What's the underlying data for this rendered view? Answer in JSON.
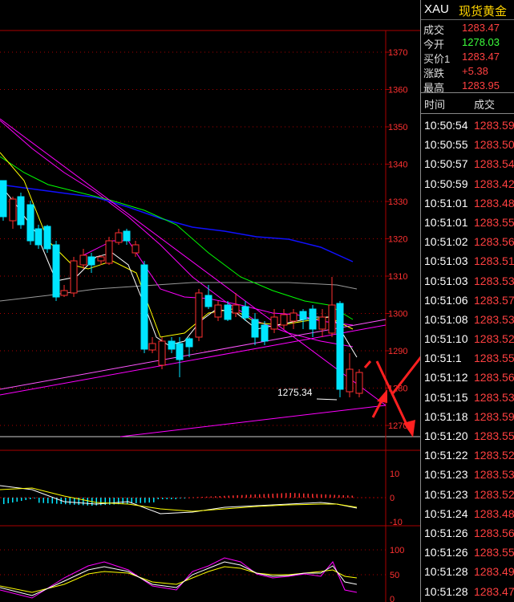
{
  "header": {
    "symbol": "XAU",
    "name": "现货黄金"
  },
  "quote": [
    {
      "label": "成交",
      "value": "1283.47",
      "color": "red"
    },
    {
      "label": "今开",
      "value": "1278.03",
      "color": "green"
    },
    {
      "label": "买价1",
      "value": "1283.47",
      "color": "red"
    },
    {
      "label": "涨跌",
      "value": "+5.38",
      "color": "red"
    },
    {
      "label": "最高",
      "value": "1283.95",
      "color": "red"
    }
  ],
  "ticks_header": {
    "time": "时间",
    "price": "成交"
  },
  "ticks": [
    {
      "time": "10:50:54",
      "price": "1283.59"
    },
    {
      "time": "10:50:55",
      "price": "1283.50"
    },
    {
      "time": "10:50:57",
      "price": "1283.54"
    },
    {
      "time": "10:50:59",
      "price": "1283.42"
    },
    {
      "time": "10:51:01",
      "price": "1283.48"
    },
    {
      "time": "10:51:01",
      "price": "1283.55"
    },
    {
      "time": "10:51:02",
      "price": "1283.56"
    },
    {
      "time": "10:51:03",
      "price": "1283.51"
    },
    {
      "time": "10:51:03",
      "price": "1283.53"
    },
    {
      "time": "10:51:06",
      "price": "1283.57"
    },
    {
      "time": "10:51:08",
      "price": "1283.53"
    },
    {
      "time": "10:51:10",
      "price": "1283.52"
    },
    {
      "time": "10:51:1",
      "price": "1283.55"
    },
    {
      "time": "10:51:12",
      "price": "1283.56"
    },
    {
      "time": "10:51:15",
      "price": "1283.53"
    },
    {
      "time": "10:51:18",
      "price": "1283.59"
    },
    {
      "time": "10:51:20",
      "price": "1283.55"
    },
    {
      "time": "10:51:22",
      "price": "1283.52"
    },
    {
      "time": "10:51:23",
      "price": "1283.53"
    },
    {
      "time": "10:51:23",
      "price": "1283.52"
    },
    {
      "time": "10:51:24",
      "price": "1283.48"
    },
    {
      "time": "10:51:26",
      "price": "1283.56"
    },
    {
      "time": "10:51:26",
      "price": "1283.55"
    },
    {
      "time": "10:51:28",
      "price": "1283.49"
    },
    {
      "time": "10:51:28",
      "price": "1283.47"
    }
  ],
  "price_axis": [
    "1370",
    "1360",
    "1350",
    "1340",
    "1330",
    "1320",
    "1310",
    "1300",
    "1290",
    "1280",
    "1270"
  ],
  "macd_axis": [
    "10",
    "0",
    "-10"
  ],
  "kdj_axis": [
    "100",
    "50",
    "0"
  ],
  "annotation": {
    "low_price": "1275.34"
  },
  "colors": {
    "up": "#ff3030",
    "down": "#00e5ff",
    "ma_short": "#ffffff",
    "ma_mid": "#ffff00",
    "ma_long": "#ff00ff",
    "ma_60": "#00ff00",
    "ma_120": "#0033ff",
    "ma_250": "#999999",
    "arrow": "#ff2020"
  }
}
